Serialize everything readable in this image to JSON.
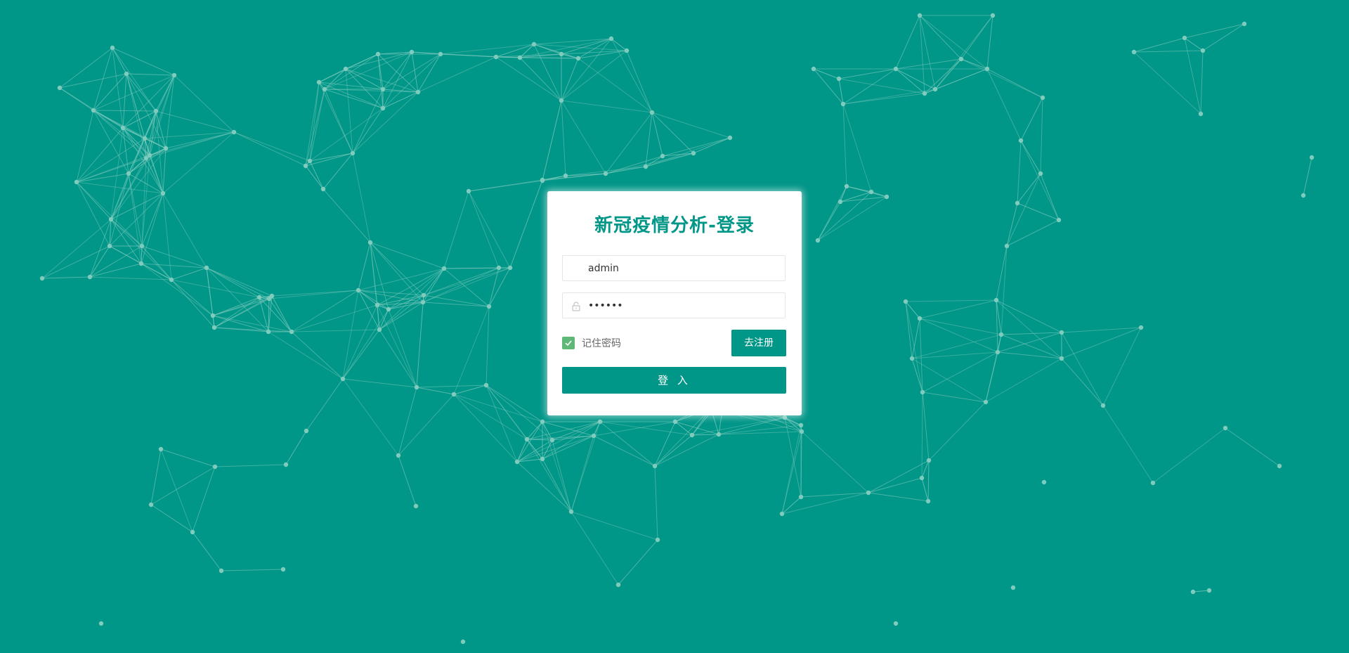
{
  "login": {
    "title": "新冠疫情分析-登录",
    "username_value": "admin",
    "password_value": "••••••",
    "remember_label": "记住密码",
    "remember_checked": true,
    "register_label": "去注册",
    "login_label": "登 入"
  },
  "theme": {
    "background": "#009688",
    "accent": "#009688",
    "checkbox": "#5FB878",
    "network_line": "#7fcbbe"
  }
}
